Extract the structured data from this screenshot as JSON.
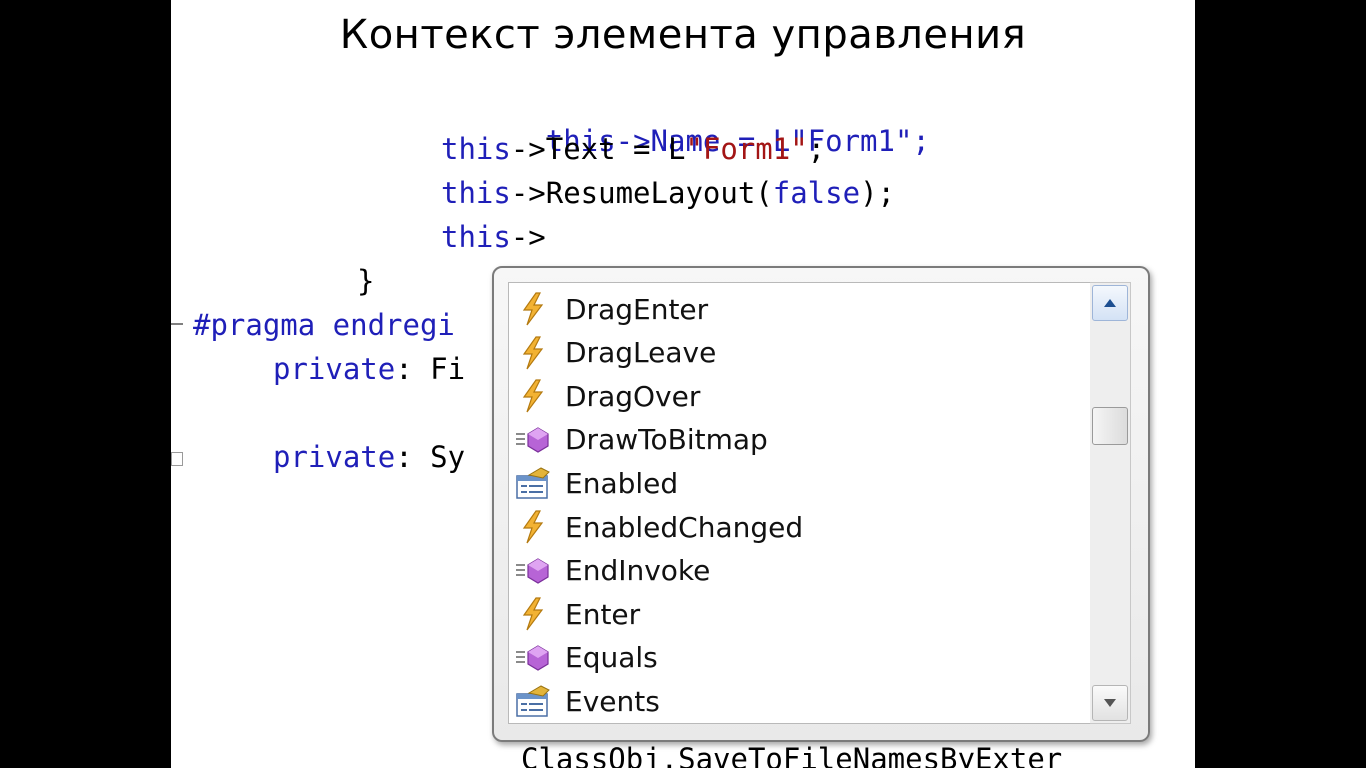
{
  "slide": {
    "title": "Контекст элемента управления"
  },
  "code": {
    "line_partial": "this->Name = L\"Form1\";",
    "line1": {
      "kw": "this",
      "arrow": "->Text = L",
      "str": "\"Form1\"",
      "end": ";"
    },
    "line2": {
      "kw": "this",
      "arrow": "->ResumeLayout(",
      "kw2": "false",
      "end": ");"
    },
    "line3": {
      "kw": "this",
      "arrow": "->"
    },
    "brace": "}",
    "pragma": "#pragma endregi",
    "private1": {
      "kw": "private",
      "rest": ": Fi"
    },
    "private2": {
      "kw": "private",
      "rest": ": Sy"
    },
    "bottom_partial": "ClassObj.SaveToFileNamesByExter"
  },
  "completion": {
    "items": [
      {
        "label": "DragEnter",
        "icon": "event-icon"
      },
      {
        "label": "DragLeave",
        "icon": "event-icon"
      },
      {
        "label": "DragOver",
        "icon": "event-icon"
      },
      {
        "label": "DrawToBitmap",
        "icon": "method-icon"
      },
      {
        "label": "Enabled",
        "icon": "property-icon"
      },
      {
        "label": "EnabledChanged",
        "icon": "event-icon"
      },
      {
        "label": "EndInvoke",
        "icon": "method-icon"
      },
      {
        "label": "Enter",
        "icon": "event-icon"
      },
      {
        "label": "Equals",
        "icon": "method-icon"
      },
      {
        "label": "Events",
        "icon": "property-icon"
      }
    ]
  }
}
